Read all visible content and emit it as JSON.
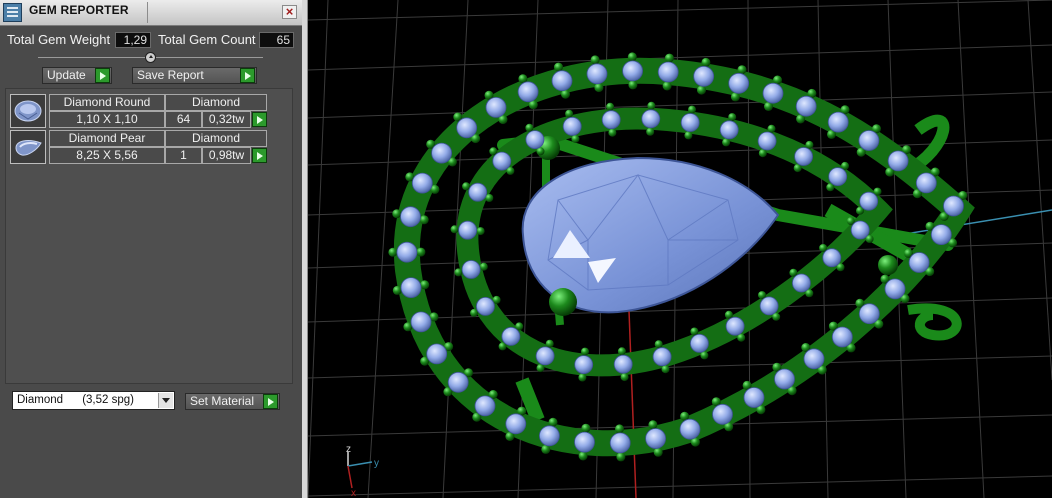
{
  "window": {
    "title": "GEM REPORTER"
  },
  "icons": {
    "app": "gem-reporter-app-icon",
    "close": "close-icon",
    "run": "green-play-arrow-icon",
    "dropdown": "chevron-down-icon"
  },
  "colors": {
    "panel_bg": "#4a4a4a",
    "accent_green": "#2c9a2c",
    "metal": "#1f8a1f",
    "gem": "#8aa6e8",
    "grid": "#3c3c3c"
  },
  "stats": {
    "total_weight_label": "Total Gem Weight",
    "total_weight_value": "1,29",
    "total_count_label": "Total Gem Count",
    "total_count_value": "65"
  },
  "buttons": {
    "update": "Update",
    "save_report": "Save Report",
    "set_material": "Set Material"
  },
  "gems": [
    {
      "name": "Diamond Round",
      "material": "Diamond",
      "size": "1,10 X 1,10",
      "count": "64",
      "weight": "0,32tw",
      "shape": "round"
    },
    {
      "name": "Diamond Pear",
      "material": "Diamond",
      "size": "8,25 X 5,56",
      "count": "1",
      "weight": "0,98tw",
      "shape": "pear"
    }
  ],
  "material": {
    "selected": "Diamond      (3,52 spg)"
  },
  "axes": {
    "z": "z",
    "y": "y",
    "x": "x"
  }
}
